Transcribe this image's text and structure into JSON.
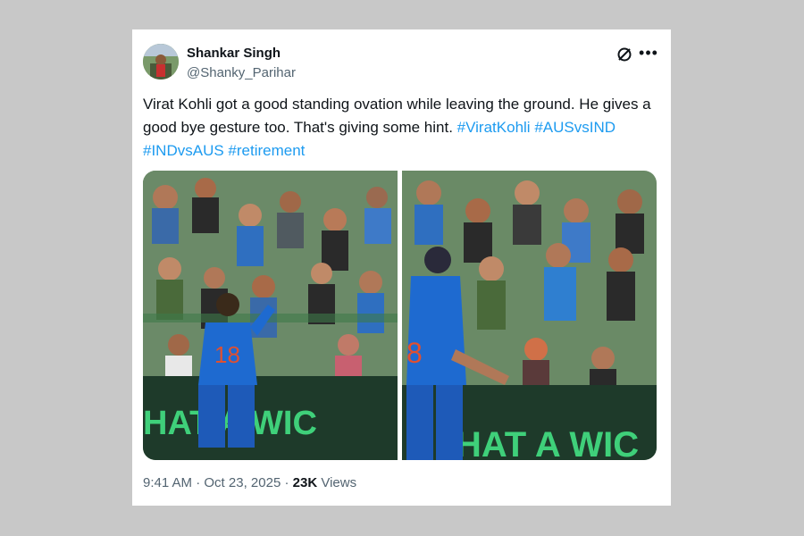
{
  "author": {
    "name": "Shankar Singh",
    "handle": "@Shanky_Parihar"
  },
  "tweet": {
    "text_plain": "Virat Kohli got a good standing ovation while leaving the ground. He gives a good bye gesture too. That's giving some hint.",
    "hashtags": [
      "#ViratKohli",
      "#AUSvsIND",
      "#INDvsAUS",
      "#retirement"
    ]
  },
  "media": {
    "left_board_text": "HAT A WIC",
    "right_board_text": "HAT A WIC",
    "jersey_number": "18",
    "jersey_number_right": "8"
  },
  "meta": {
    "time": "9:41 AM",
    "sep1": "·",
    "date": "Oct 23, 2025",
    "sep2": "·",
    "views_count": "23K",
    "views_label": "Views"
  },
  "colors": {
    "hashtag": "#1d9bf0",
    "text": "#0f1419",
    "muted": "#536471",
    "background": "#c8c8c8"
  }
}
